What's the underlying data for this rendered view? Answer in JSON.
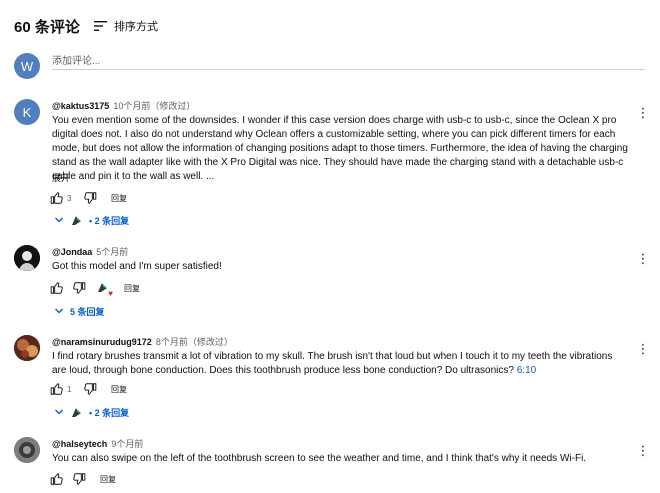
{
  "header": {
    "count": "60 条评论",
    "sort_label": "排序方式"
  },
  "add_comment": {
    "avatar_letter": "W",
    "placeholder": "添加评论..."
  },
  "comments": [
    {
      "author": "@kaktus3175",
      "time": "10个月前（修改过）",
      "avatar_letter": "K",
      "text": "You even mention some of the downsides. I wonder if this case version does charge with usb-c to usb-c, since the Oclean X pro digital does not. I also do not understand why Oclean offers a customizable setting, where you can pick different timers for each mode, but does not allow the information of changing positions adapt to those timers. Furthermore, the idea of having the charging stand as the wall adapter like with the X Pro Digital was nice. They should have made the charging stand with a detachable usb-c cable and pin it to the wall as well. ...",
      "more": "展开",
      "likes": "3",
      "reply_label": "回复",
      "replies_label": "2 条回复"
    },
    {
      "author": "@Jondaa",
      "time": "5个月前",
      "text": "Got this model and I'm super satisfied!",
      "likes": "",
      "reply_label": "回复",
      "replies_label": "5 条回复"
    },
    {
      "author": "@naramsinurudug9172",
      "time": "8个月前（修改过）",
      "text_before": "I find rotary brushes transmit a lot of vibration to my skull. The brush isn't that loud but when I touch it to my teeth the vibrations are loud, through bone conduction. Does this toothbrush produce less bone conduction? Do ultrasonics? ",
      "timestamp": "6:10",
      "likes": "1",
      "reply_label": "回复",
      "replies_label": "2 条回复"
    },
    {
      "author": "@halseytech",
      "time": "9个月前",
      "text": "You can also swipe on the left of the toothbrush screen to see the weather and time, and I think that's why it needs Wi-Fi.",
      "likes": "",
      "reply_label": "回复"
    }
  ],
  "colors": {
    "link": "#065fd4",
    "muted": "#606060",
    "avatar_blue": "#4f7fbf",
    "heart": "#e62117"
  },
  "icons": [
    "sort-icon",
    "thumb-up-icon",
    "thumb-down-icon",
    "kebab-menu-icon",
    "chevron-down-icon",
    "creator-avatar-icon",
    "heart-icon"
  ]
}
